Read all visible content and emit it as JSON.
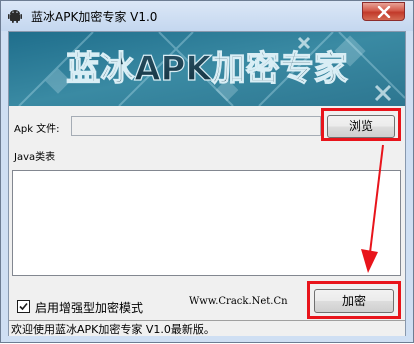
{
  "window": {
    "title": "蓝冰APK加密专家 V1.0"
  },
  "banner": {
    "title": "蓝冰APK加密专家"
  },
  "form": {
    "apk_label": "Apk 文件:",
    "apk_value": "",
    "browse_label": "浏览",
    "java_label": "Java类表",
    "enhanced_label": "启用增强型加密模式",
    "enhanced_checked": true,
    "encrypt_label": "加密"
  },
  "watermark": "Www.Crack.Net.Cn",
  "statusbar": {
    "text": "欢迎使用蓝冰APK加密专家 V1.0最新版。"
  },
  "colors": {
    "annotation": "#e8141b",
    "banner_bg": "#2c7a95",
    "banner_text": "#1f3f50"
  }
}
